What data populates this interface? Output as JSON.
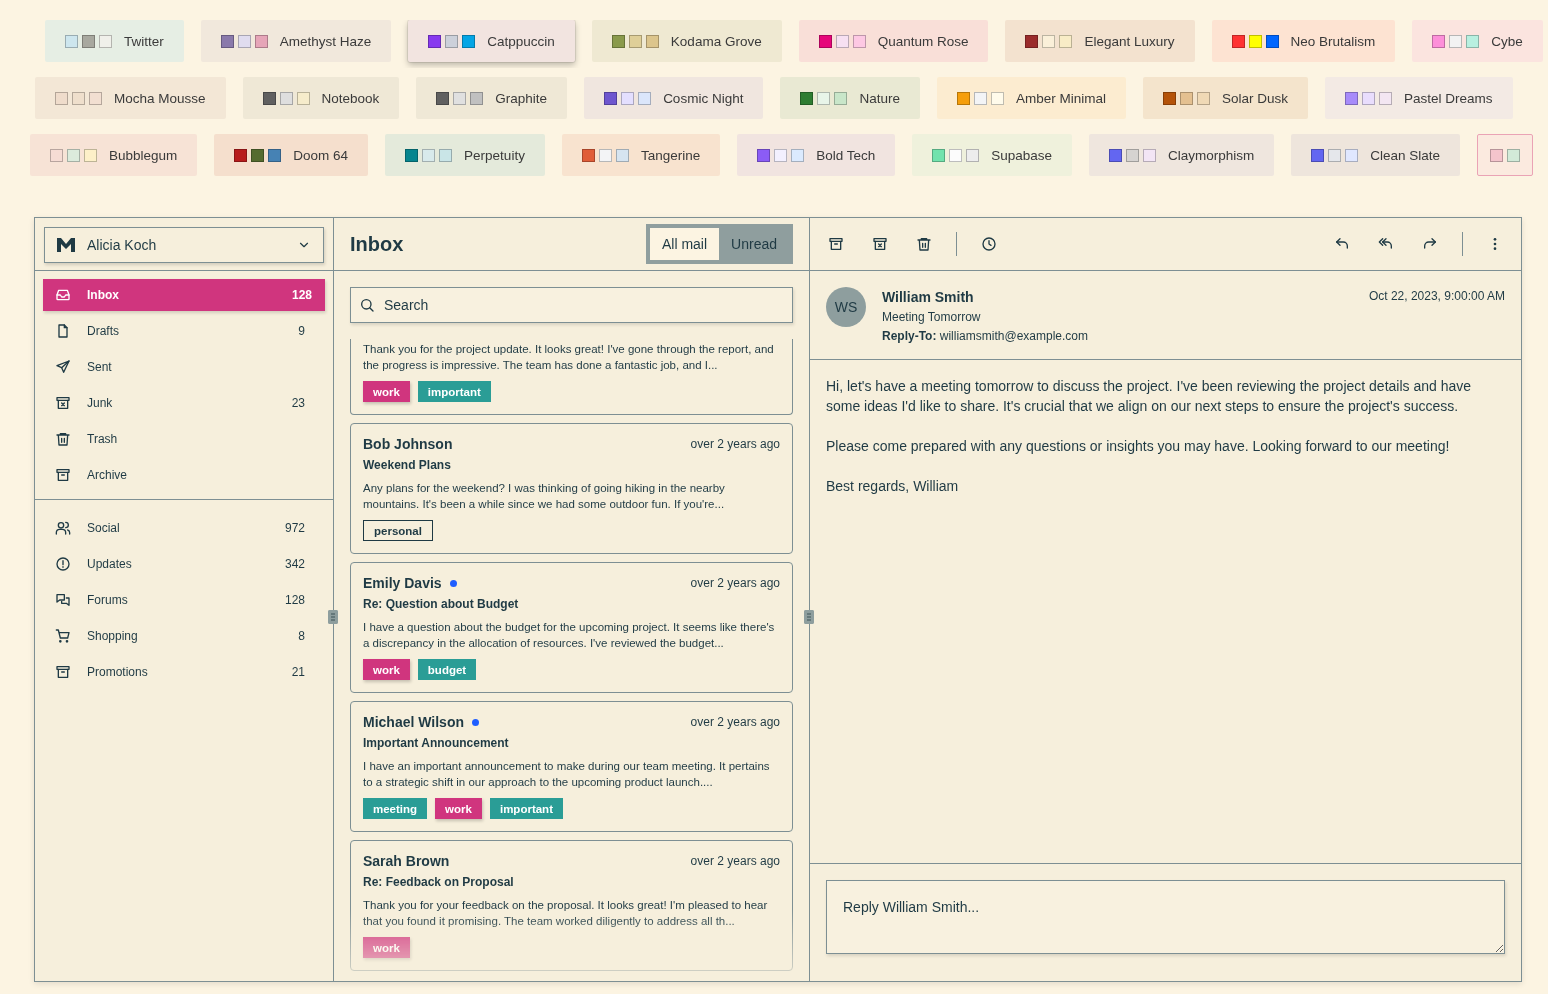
{
  "theme_rows": [
    {
      "chips": [
        {
          "label": "Twitter",
          "selected": false,
          "color": "#e6eee4",
          "swatches": [
            {
              "color": "#cde6ee"
            },
            {
              "color": "#a8a89f"
            },
            {
              "color": "#f0f0ea"
            }
          ]
        },
        {
          "label": "Amethyst Haze",
          "selected": false,
          "color": "#f1e8dc",
          "swatches": [
            {
              "color": "#8a79ab"
            },
            {
              "color": "#e0dcef"
            },
            {
              "color": "#e6a5b8"
            }
          ]
        },
        {
          "label": "Catppuccin",
          "selected": true,
          "color": "#f2e4e0",
          "swatches": [
            {
              "color": "#8839ef"
            },
            {
              "color": "#ccd0da"
            },
            {
              "color": "#04a5e5"
            }
          ]
        },
        {
          "label": "Kodama Grove",
          "selected": false,
          "color": "#efe9d2",
          "swatches": [
            {
              "color": "#8a9a4b"
            },
            {
              "color": "#dfcf98"
            },
            {
              "color": "#dcc58c"
            }
          ]
        },
        {
          "label": "Quantum Rose",
          "selected": false,
          "color": "#f9dfd8",
          "swatches": [
            {
              "color": "#e6067a"
            },
            {
              "color": "#f7e0f2"
            },
            {
              "color": "#fdc8e3"
            }
          ]
        },
        {
          "label": "Elegant Luxury",
          "selected": false,
          "color": "#f3e2cf",
          "swatches": [
            {
              "color": "#9b2c2c"
            },
            {
              "color": "#faf0d9"
            },
            {
              "color": "#f8ecc6"
            }
          ]
        },
        {
          "label": "Neo Brutalism",
          "selected": false,
          "color": "#fde3d2",
          "swatches": [
            {
              "color": "#ff3333"
            },
            {
              "color": "#ffff00"
            },
            {
              "color": "#0066ff"
            }
          ]
        },
        {
          "label": "Cybe",
          "selected": false,
          "color": "#fbe4df",
          "swatches": [
            {
              "color": "#fd8fd9"
            },
            {
              "color": "#f2f2f2"
            },
            {
              "color": "#b8f0e0"
            }
          ]
        }
      ]
    },
    {
      "chips": [
        {
          "label": "Mocha Mousse",
          "selected": false,
          "color": "#f3e7d6",
          "swatches": [
            {
              "color": "#efdccb"
            },
            {
              "color": "#efdfcc"
            },
            {
              "color": "#f2dfd1"
            }
          ]
        },
        {
          "label": "Notebook",
          "selected": false,
          "color": "#efe8d6",
          "swatches": [
            {
              "color": "#606060"
            },
            {
              "color": "#dedede"
            },
            {
              "color": "#f6eccb"
            }
          ]
        },
        {
          "label": "Graphite",
          "selected": false,
          "color": "#efe8d6",
          "swatches": [
            {
              "color": "#606060"
            },
            {
              "color": "#e0e0e0"
            },
            {
              "color": "#c0c0c0"
            }
          ]
        },
        {
          "label": "Cosmic Night",
          "selected": false,
          "color": "#f0e6df",
          "swatches": [
            {
              "color": "#6e56cf"
            },
            {
              "color": "#e4dfff"
            },
            {
              "color": "#dbe6fb"
            }
          ]
        },
        {
          "label": "Nature",
          "selected": false,
          "color": "#e9e9d3",
          "swatches": [
            {
              "color": "#2e7d32"
            },
            {
              "color": "#e8f5e9"
            },
            {
              "color": "#c8e6c9"
            }
          ]
        },
        {
          "label": "Amber Minimal",
          "selected": false,
          "color": "#fcecd0",
          "swatches": [
            {
              "color": "#f59e0b"
            },
            {
              "color": "#f3f4f6"
            },
            {
              "color": "#fffbeb"
            }
          ]
        },
        {
          "label": "Solar Dusk",
          "selected": false,
          "color": "#f4e4cc",
          "swatches": [
            {
              "color": "#b45309"
            },
            {
              "color": "#e4c090"
            },
            {
              "color": "#f0d9b5"
            }
          ]
        },
        {
          "label": "Pastel Dreams",
          "selected": false,
          "color": "#f3eae4",
          "swatches": [
            {
              "color": "#a78bfa"
            },
            {
              "color": "#e9ddfd"
            },
            {
              "color": "#f3e6f2"
            }
          ]
        }
      ]
    },
    {
      "chips": [
        {
          "label": "Bubblegum",
          "selected": false,
          "color": "#f7e3d6",
          "swatches": [
            {
              "color": "#f6dcd4"
            },
            {
              "color": "#dcebdc"
            },
            {
              "color": "#fdf0c8"
            }
          ]
        },
        {
          "label": "Doom 64",
          "selected": false,
          "color": "#f5dfcd",
          "swatches": [
            {
              "color": "#b71c1c"
            },
            {
              "color": "#556b2f"
            },
            {
              "color": "#4682b4"
            }
          ]
        },
        {
          "label": "Perpetuity",
          "selected": false,
          "color": "#e4eadb",
          "swatches": [
            {
              "color": "#06858e"
            },
            {
              "color": "#d8eaeb"
            },
            {
              "color": "#c9e5e7"
            }
          ]
        },
        {
          "label": "Tangerine",
          "selected": false,
          "color": "#f8e3cf",
          "swatches": [
            {
              "color": "#e05d38"
            },
            {
              "color": "#f3f4f6"
            },
            {
              "color": "#d6e4f0"
            }
          ]
        },
        {
          "label": "Bold Tech",
          "selected": false,
          "color": "#f1e4e0",
          "swatches": [
            {
              "color": "#8b5cf6"
            },
            {
              "color": "#f3f0ff"
            },
            {
              "color": "#dbeafe"
            }
          ]
        },
        {
          "label": "Supabase",
          "selected": false,
          "color": "#eff1dc",
          "swatches": [
            {
              "color": "#72e3ad"
            },
            {
              "color": "#fcfcfc"
            },
            {
              "color": "#ededed"
            }
          ]
        },
        {
          "label": "Claymorphism",
          "selected": false,
          "color": "#efe6de",
          "swatches": [
            {
              "color": "#6366f1"
            },
            {
              "color": "#d6d3d1"
            },
            {
              "color": "#f3e5f5"
            }
          ]
        },
        {
          "label": "Clean Slate",
          "selected": false,
          "color": "#eee5dc",
          "swatches": [
            {
              "color": "#6366f1"
            },
            {
              "color": "#e5e7eb"
            },
            {
              "color": "#e0e7ff"
            }
          ]
        },
        {
          "selected": false,
          "color": "#fbeadf",
          "swatches": [
            {
              "color": "#f4c4cc"
            },
            {
              "color": "#d2ead8"
            }
          ]
        }
      ]
    }
  ],
  "sidebar": {
    "account": {
      "name": "Alicia Koch"
    },
    "groups": [
      [
        {
          "label": "Inbox",
          "count": "128",
          "selected": true
        },
        {
          "label": "Drafts",
          "count": "9",
          "selected": false
        },
        {
          "label": "Sent",
          "selected": false
        },
        {
          "label": "Junk",
          "count": "23",
          "selected": false
        },
        {
          "label": "Trash",
          "selected": false
        },
        {
          "label": "Archive",
          "selected": false
        }
      ],
      [
        {
          "label": "Social",
          "count": "972",
          "selected": false
        },
        {
          "label": "Updates",
          "count": "342",
          "selected": false
        },
        {
          "label": "Forums",
          "count": "128",
          "selected": false
        },
        {
          "label": "Shopping",
          "count": "8",
          "selected": false
        },
        {
          "label": "Promotions",
          "count": "21",
          "selected": false
        }
      ]
    ]
  },
  "mail_list": {
    "title": "Inbox",
    "tabs": [
      {
        "label": "All mail",
        "selected": true
      },
      {
        "label": "Unread",
        "selected": false
      }
    ],
    "search": {
      "placeholder": "Search"
    },
    "mails": [
      {
        "preview": "Thank you for the project update. It looks great! I've gone through the report, and the progress is impressive. The team has done a fantastic job, and I...",
        "tags": [
          {
            "label": "work",
            "kind": "primary"
          },
          {
            "label": "important",
            "kind": "secondary"
          }
        ]
      },
      {
        "name": "Bob Johnson",
        "unread": false,
        "date": "over 2 years ago",
        "subject": "Weekend Plans",
        "preview": "Any plans for the weekend? I was thinking of going hiking in the nearby mountains. It's been a while since we had some outdoor fun. If you're...",
        "tags": [
          {
            "label": "personal",
            "kind": "outline"
          }
        ]
      },
      {
        "name": "Emily Davis",
        "unread": true,
        "date": "over 2 years ago",
        "subject": "Re: Question about Budget",
        "preview": "I have a question about the budget for the upcoming project. It seems like there's a discrepancy in the allocation of resources. I've reviewed the budget...",
        "tags": [
          {
            "label": "work",
            "kind": "primary"
          },
          {
            "label": "budget",
            "kind": "secondary"
          }
        ]
      },
      {
        "name": "Michael Wilson",
        "unread": true,
        "date": "over 2 years ago",
        "subject": "Important Announcement",
        "preview": "I have an important announcement to make during our team meeting. It pertains to a strategic shift in our approach to the upcoming product launch....",
        "tags": [
          {
            "label": "meeting",
            "kind": "secondary"
          },
          {
            "label": "work",
            "kind": "primary"
          },
          {
            "label": "important",
            "kind": "secondary"
          }
        ]
      },
      {
        "name": "Sarah Brown",
        "unread": false,
        "date": "over 2 years ago",
        "subject": "Re: Feedback on Proposal",
        "preview": "Thank you for your feedback on the proposal. It looks great! I'm pleased to hear that you found it promising. The team worked diligently to address all th...",
        "tags": [
          {
            "label": "work",
            "kind": "primary"
          }
        ]
      }
    ]
  },
  "mail_view": {
    "sender": {
      "initials": "WS",
      "name": "William Smith",
      "subject": "Meeting Tomorrow",
      "reply_to": "**Reply-To:** williamsmith@example.com",
      "date": "Oct 22, 2023, 9:00:00 AM"
    },
    "body": [
      "Hi, let's have a meeting tomorrow to discuss the project. I've been reviewing the project details and have some ideas I'd like to share. It's crucial that we align on our next steps to ensure the project's success.",
      "Please come prepared with any questions or insights you may have. Looking forward to our meeting!",
      "Best regards, William"
    ],
    "reply": {
      "placeholder": "Reply William Smith..."
    }
  }
}
